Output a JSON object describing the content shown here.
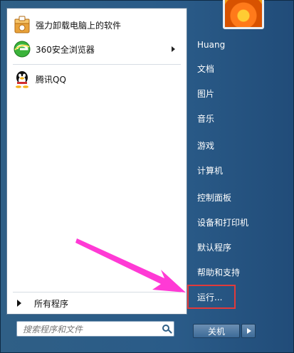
{
  "left_programs": [
    {
      "label": "强力卸载电脑上的软件",
      "icon": "uninstaller-box-icon"
    },
    {
      "label": "360安全浏览器",
      "icon": "360-browser-icon",
      "has_submenu": true
    },
    {
      "label": "腾讯QQ",
      "icon": "qq-penguin-icon"
    }
  ],
  "all_programs": "所有程序",
  "search": {
    "placeholder": "搜索程序和文件"
  },
  "right_items": [
    "Huang",
    "文档",
    "图片",
    "音乐",
    "游戏",
    "计算机",
    "控制面板",
    "设备和打印机",
    "默认程序",
    "帮助和支持",
    "运行..."
  ],
  "shutdown": {
    "label": "关机"
  },
  "colors": {
    "highlight_box": "#e23a3a",
    "annotation_arrow": "#ff3ad5"
  }
}
